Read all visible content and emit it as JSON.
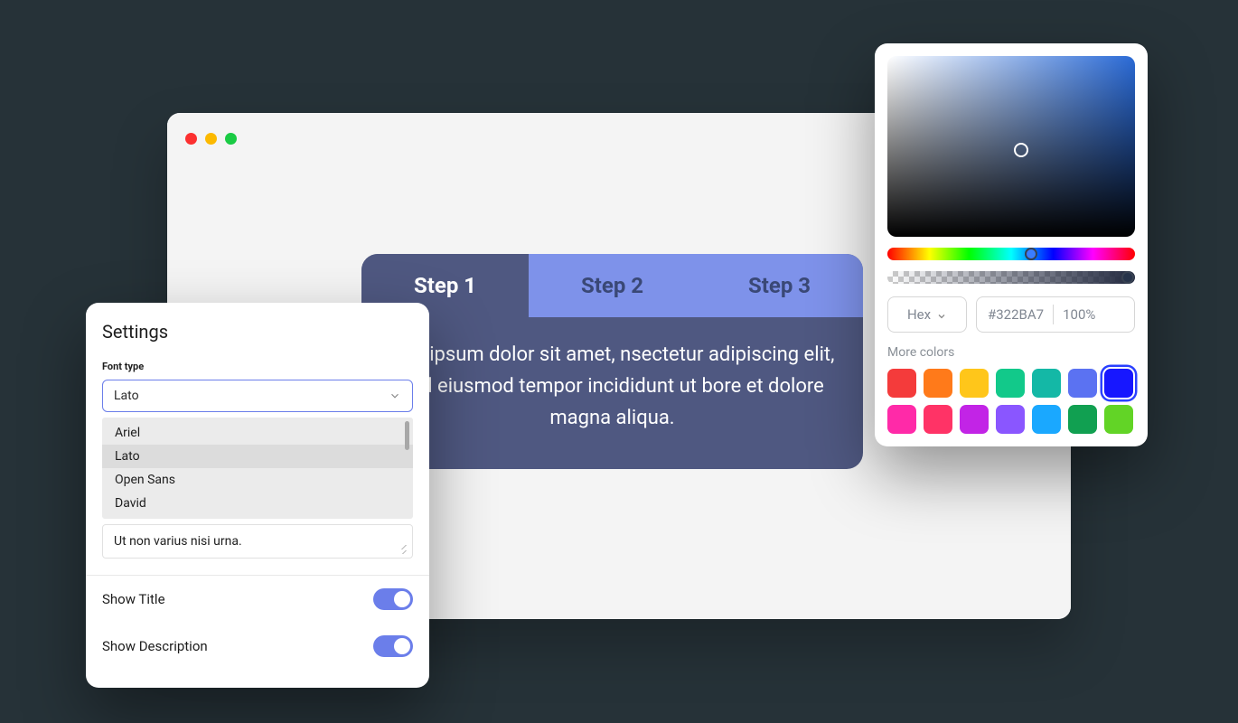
{
  "browser": {
    "traffic": [
      "red",
      "yellow",
      "green"
    ]
  },
  "stepper": {
    "tabs": [
      {
        "label": "Step 1",
        "active": true
      },
      {
        "label": "Step 2",
        "active": false
      },
      {
        "label": "Step 3",
        "active": false
      }
    ],
    "body": "rem ipsum dolor sit amet, nsectetur adipiscing elit, sed eiusmod tempor incididunt ut bore et dolore magna aliqua."
  },
  "settings": {
    "title": "Settings",
    "font_label": "Font type",
    "selected_font": "Lato",
    "options": [
      "Ariel",
      "Lato",
      "Open Sans",
      "David"
    ],
    "textarea_value": "Ut non varius nisi urna.",
    "toggles": [
      {
        "label": "Show Title",
        "on": true
      },
      {
        "label": "Show Description",
        "on": true
      }
    ]
  },
  "picker": {
    "format_label": "Hex",
    "hex_value": "#322BA7",
    "opacity_value": "100%",
    "more_label": "More colors",
    "swatches": [
      {
        "color": "#f43b3b",
        "selected": false
      },
      {
        "color": "#ff7a1a",
        "selected": false
      },
      {
        "color": "#ffc61a",
        "selected": false
      },
      {
        "color": "#12c98a",
        "selected": false
      },
      {
        "color": "#14b8a6",
        "selected": false
      },
      {
        "color": "#5b72f2",
        "selected": false
      },
      {
        "color": "#1717ff",
        "selected": true
      },
      {
        "color": "#ff2aa8",
        "selected": false
      },
      {
        "color": "#ff3366",
        "selected": false
      },
      {
        "color": "#c224e6",
        "selected": false
      },
      {
        "color": "#8a56ff",
        "selected": false
      },
      {
        "color": "#1aa8ff",
        "selected": false
      },
      {
        "color": "#11a051",
        "selected": false
      },
      {
        "color": "#62d426",
        "selected": false
      }
    ]
  }
}
